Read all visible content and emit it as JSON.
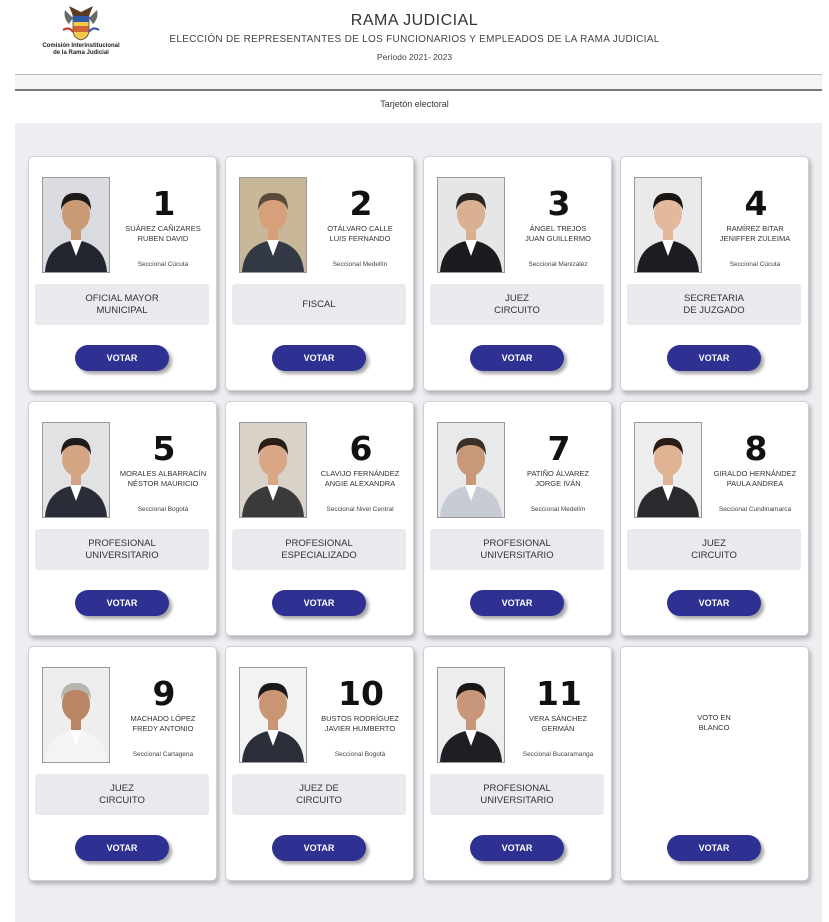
{
  "header": {
    "logo_text": "Comisión Interinstitucional de la Rama Judicial",
    "title": "RAMA JUDICIAL",
    "subtitle": "ELECCIÓN DE REPRESENTANTES DE LOS FUNCIONARIOS Y EMPLEADOS DE LA RAMA JUDICIAL",
    "period": "Período 2021- 2023"
  },
  "ballot": {
    "title": "Tarjetón electoral"
  },
  "colors": {
    "vote_button": "#2e3192",
    "panel_bg": "#ededf2",
    "cargo_bg": "#e9e9ee"
  },
  "candidates": [
    {
      "number": "1",
      "name": "SUÁREZ CAÑIZARES\nRUBEN DAVID",
      "seccional": "Seccional Cúcuta",
      "cargo": "OFICIAL MAYOR\nMUNICIPAL",
      "vote": "VOTAR",
      "photo": {
        "skin": "#c99a74",
        "hair": "#1e1a17",
        "suit": "#23262e",
        "bg": "#d9dbe0"
      }
    },
    {
      "number": "2",
      "name": "OTÁLVARO CALLE\nLUIS FERNANDO",
      "seccional": "Seccional Medellín",
      "cargo": "FISCAL",
      "vote": "VOTAR",
      "photo": {
        "skin": "#d7a07a",
        "hair": "#5a4a3a",
        "suit": "#333a46",
        "bg": "#c9b79a"
      }
    },
    {
      "number": "3",
      "name": "ÁNGEL TREJOS\nJUAN GUILLERMO",
      "seccional": "Seccional Manizalez",
      "cargo": "JUEZ\nCIRCUITO",
      "vote": "VOTAR",
      "photo": {
        "skin": "#d9b092",
        "hair": "#2a2420",
        "suit": "#1c1c20",
        "bg": "#e6e6e6"
      }
    },
    {
      "number": "4",
      "name": "RAMÍREZ BITAR\nJENIFFER ZULEIMA",
      "seccional": "Seccional Cúcuta",
      "cargo": "SECRETARIA\nDE JUZGADO",
      "vote": "VOTAR",
      "photo": {
        "skin": "#e3b89c",
        "hair": "#1a1412",
        "suit": "#1c1c22",
        "bg": "#e9e9ea"
      }
    },
    {
      "number": "5",
      "name": "MORALES ALBARRACÍN\nNÉSTOR MAURICIO",
      "seccional": "Seccional Bogotá",
      "cargo": "PROFESIONAL\nUNIVERSITARIO",
      "vote": "VOTAR",
      "photo": {
        "skin": "#d3a583",
        "hair": "#1f1b18",
        "suit": "#2a2d38",
        "bg": "#e2e2e4"
      }
    },
    {
      "number": "6",
      "name": "CLAVIJO FERNÁNDEZ\nANGIE ALEXANDRA",
      "seccional": "Seccional Nivel Central",
      "cargo": "PROFESIONAL\nESPECIALIZADO",
      "vote": "VOTAR",
      "photo": {
        "skin": "#d9a785",
        "hair": "#2a1d16",
        "suit": "#3a3a3a",
        "bg": "#d9d2c8"
      }
    },
    {
      "number": "7",
      "name": "PATIÑO ÁLVAREZ\nJORGE IVÁN",
      "seccional": "Seccional Medellín",
      "cargo": "PROFESIONAL\nUNIVERSITARIO",
      "vote": "VOTAR",
      "photo": {
        "skin": "#c89878",
        "hair": "#3a302a",
        "suit": "#c7ccd4",
        "bg": "#e8e9eb"
      }
    },
    {
      "number": "8",
      "name": "GIRALDO HERNÁNDEZ\nPAULA ANDREA",
      "seccional": "Seccional Cundinamarca",
      "cargo": "JUEZ\nCIRCUITO",
      "vote": "VOTAR",
      "photo": {
        "skin": "#e0b294",
        "hair": "#2a1c14",
        "suit": "#2a2a2e",
        "bg": "#ededee"
      }
    },
    {
      "number": "9",
      "name": "MACHADO LÓPEZ\nFREDY ANTONIO",
      "seccional": "Seccional Cartagena",
      "cargo": "JUEZ\nCIRCUITO",
      "vote": "VOTAR",
      "photo": {
        "skin": "#b98564",
        "hair": "#b8b4ae",
        "suit": "#f4f4f4",
        "bg": "#eeeeee"
      }
    },
    {
      "number": "10",
      "name": "BUSTOS RODRÍGUEZ\nJAVIER HUMBERTO",
      "seccional": "Seccional Bogotá",
      "cargo": "JUEZ DE\nCIRCUITO",
      "vote": "VOTAR",
      "photo": {
        "skin": "#c99574",
        "hair": "#1c1816",
        "suit": "#2b2f3a",
        "bg": "#f2f2f2"
      }
    },
    {
      "number": "11",
      "name": "VERA SÁNCHEZ\nGERMÁN",
      "seccional": "Seccional Bucaramanga",
      "cargo": "PROFESIONAL\nUNIVERSITARIO",
      "vote": "VOTAR",
      "photo": {
        "skin": "#c8967a",
        "hair": "#1a1614",
        "suit": "#1e1f24",
        "bg": "#ededed"
      }
    }
  ],
  "blank_vote": {
    "label": "VOTO EN\nBLANCO",
    "vote": "VOTAR"
  }
}
